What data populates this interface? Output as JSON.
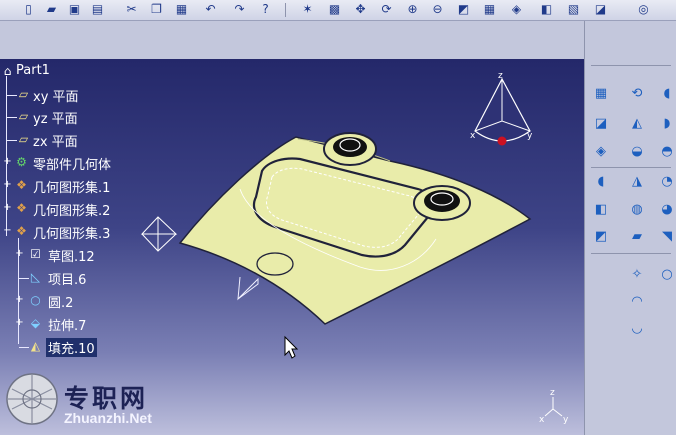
{
  "colors": {
    "surface": "#e9ecaa",
    "surface_edge": "#20223a",
    "tree_text": "#ffffff",
    "viewport_top": "#24286a",
    "viewport_bottom": "#bdbfdc",
    "compass_red": "#cc1122"
  },
  "toolbar": {
    "icons": [
      "new-icon",
      "open-icon",
      "save-icon",
      "print-icon",
      "cut-icon",
      "copy-icon",
      "paste-icon",
      "undo-icon",
      "redo-icon",
      "whats-this-icon",
      "fly-mode-icon",
      "fit-all-icon",
      "pan-icon",
      "rotate-icon",
      "zoom-in-icon",
      "zoom-out-icon",
      "normal-view-icon",
      "multi-view-icon",
      "iso-view-icon",
      "shading-icon",
      "hide-show-icon",
      "swap-space-icon"
    ]
  },
  "tree": {
    "root": "Part1",
    "items": [
      {
        "label": "xy 平面",
        "icon": "plane-icon"
      },
      {
        "label": "yz 平面",
        "icon": "plane-icon"
      },
      {
        "label": "zx 平面",
        "icon": "plane-icon"
      },
      {
        "label": "零部件几何体",
        "icon": "part-body-icon"
      },
      {
        "label": "几何图形集.1",
        "icon": "geometrical-set-icon"
      },
      {
        "label": "几何图形集.2",
        "icon": "geometrical-set-icon"
      },
      {
        "label": "几何图形集.3",
        "icon": "geometrical-set-icon"
      }
    ],
    "children": [
      {
        "label": "草图.12",
        "icon": "sketch-icon"
      },
      {
        "label": "项目.6",
        "icon": "project-icon"
      },
      {
        "label": "圆.2",
        "icon": "circle-icon"
      },
      {
        "label": "拉伸.7",
        "icon": "extrude-icon"
      },
      {
        "label": "填充.10",
        "icon": "fill-icon"
      }
    ]
  },
  "watermark": {
    "cn": "专职网",
    "url": "Zhuanzhi.Net"
  },
  "axis": {
    "x": "x",
    "y": "y",
    "z": "z"
  },
  "compass": {
    "x": "x",
    "y": "y",
    "z": "z"
  }
}
